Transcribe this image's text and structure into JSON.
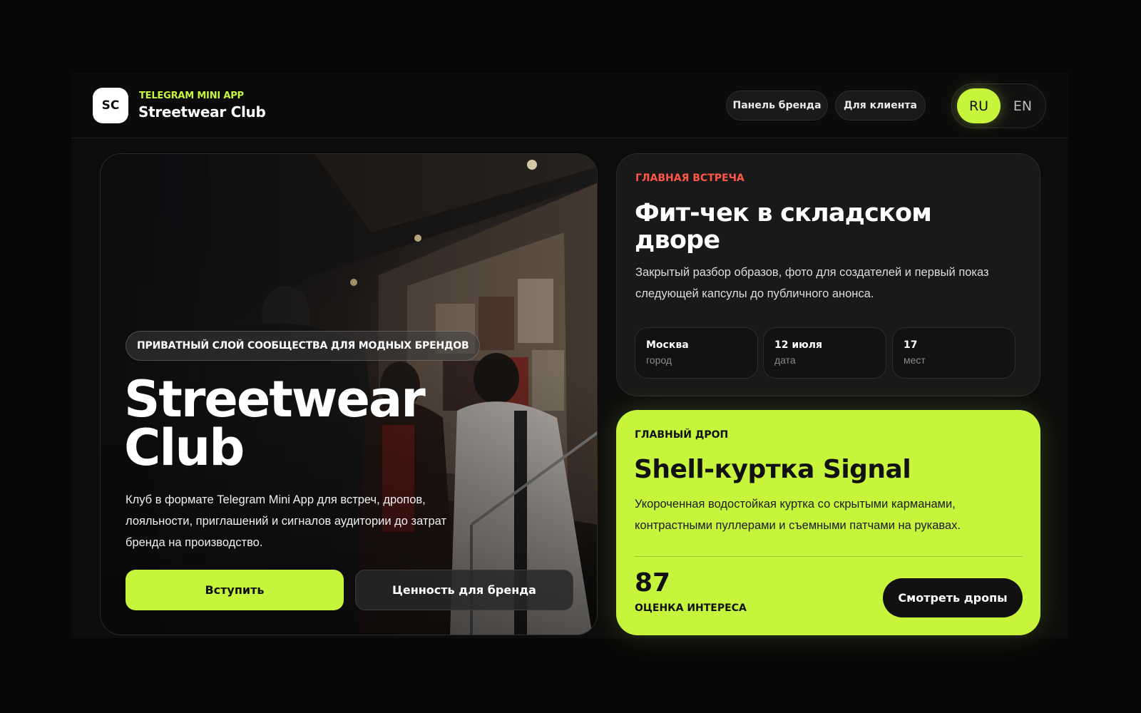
{
  "header": {
    "logo_text": "SC",
    "kicker": "TELEGRAM MINI APP",
    "title": "Streetwear Club",
    "nav": [
      {
        "label": "Панель бренда"
      },
      {
        "label": "Для клиента"
      }
    ],
    "languages": {
      "active": "RU",
      "other": "EN"
    }
  },
  "hero": {
    "tag": "ПРИВАТНЫЙ СЛОЙ СООБЩЕСТВА ДЛЯ МОДНЫХ БРЕНДОВ",
    "title_line1": "Streetwear",
    "title_line2": "Club",
    "description": "Клуб в формате Telegram Mini App для встреч, дропов, лояльности, приглашений и сигналов аудитории до затрат бренда на производство.",
    "primary_button": "Вступить",
    "secondary_button": "Ценность для бренда"
  },
  "event": {
    "kicker": "ГЛАВНАЯ ВСТРЕЧА",
    "title": "Фит-чек в складском дворе",
    "description": "Закрытый разбор образов, фото для создателей и первый показ следующей капсулы до публичного анонса.",
    "facts": [
      {
        "value": "Москва",
        "label": "город"
      },
      {
        "value": "12 июля",
        "label": "дата"
      },
      {
        "value": "17",
        "label": "мест"
      }
    ]
  },
  "drop": {
    "kicker": "ГЛАВНЫЙ ДРОП",
    "title": "Shell-куртка Signal",
    "description": "Укороченная водостойкая куртка со скрытыми карманами, контрастными пуллерами и съемными патчами на рукавах.",
    "score": "87",
    "score_label": "ОЦЕНКА ИНТЕРЕСА",
    "button": "Смотреть дропы"
  },
  "colors": {
    "accent": "#c6f53c",
    "event_kicker": "#ff5648",
    "background": "#070707",
    "card": "#191919"
  }
}
